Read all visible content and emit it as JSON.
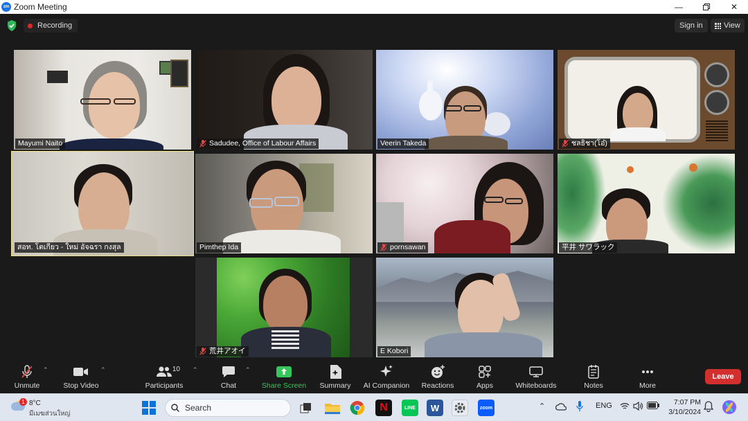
{
  "window": {
    "title": "Zoom Meeting",
    "controls": [
      "minimize-icon",
      "restore-icon",
      "close-icon"
    ]
  },
  "topbar": {
    "recording_label": "Recording",
    "signin_label": "Sign in",
    "view_label": "View"
  },
  "participants_grid": [
    {
      "name": "Mayumi Naito",
      "muted": false,
      "active_speaker": false
    },
    {
      "name": "Sadudee, Office of Labour Affairs",
      "muted": true,
      "active_speaker": false
    },
    {
      "name": "Veerin Takeda",
      "muted": false,
      "active_speaker": false
    },
    {
      "name": "ชลธิชา(โอ๋)",
      "muted": true,
      "active_speaker": false
    },
    {
      "name": "สอท. โตเกียว - ใหม่ อัจฉรา กงสุล",
      "muted": false,
      "active_speaker": true
    },
    {
      "name": "Pimthep Ida",
      "muted": false,
      "active_speaker": false
    },
    {
      "name": "pornsawan",
      "muted": true,
      "active_speaker": false
    },
    {
      "name": "平井 サワラック",
      "muted": false,
      "active_speaker": false
    },
    {
      "name": "荒井アオイ",
      "muted": true,
      "active_speaker": false
    },
    {
      "name": "E Kobori",
      "muted": false,
      "active_speaker": false
    }
  ],
  "toolbar": {
    "unmute": "Unmute",
    "stop_video": "Stop Video",
    "participants": "Participants",
    "participants_count": "10",
    "chat": "Chat",
    "share_screen": "Share Screen",
    "summary": "Summary",
    "ai_companion": "AI Companion",
    "reactions": "Reactions",
    "apps": "Apps",
    "whiteboards": "Whiteboards",
    "notes": "Notes",
    "more": "More",
    "leave": "Leave",
    "share_color": "#35c759",
    "leave_color": "#d32f2f"
  },
  "taskbar": {
    "weather_badge": "1",
    "temperature": "8°C",
    "condition": "มีเมฆส่วนใหญ่",
    "search_placeholder": "Search",
    "language": "ENG",
    "time": "7:07 PM",
    "date": "3/10/2024",
    "apps": [
      "file-explorer-icon",
      "chrome-icon",
      "netflix-icon",
      "line-icon",
      "word-icon",
      "settings-icon",
      "zoom-icon"
    ]
  }
}
